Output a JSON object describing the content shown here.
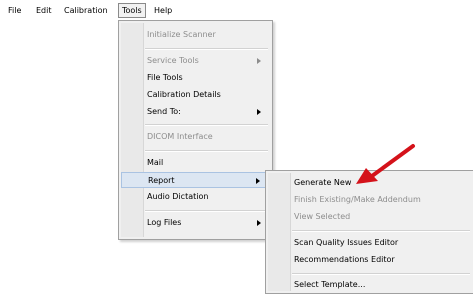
{
  "menubar": {
    "items": [
      {
        "label": "File"
      },
      {
        "label": "Edit"
      },
      {
        "label": "Calibration"
      },
      {
        "label": "Tools"
      },
      {
        "label": "Help"
      }
    ]
  },
  "tools_menu": {
    "items": [
      {
        "label": "Initialize Scanner",
        "enabled": false
      },
      {
        "label": "Service Tools",
        "enabled": false,
        "submenu": true
      },
      {
        "label": "File Tools",
        "enabled": true
      },
      {
        "label": "Calibration Details",
        "enabled": true
      },
      {
        "label": "Send To:",
        "enabled": true,
        "submenu": true
      },
      {
        "label": "DICOM Interface",
        "enabled": false
      },
      {
        "label": "Mail",
        "enabled": true
      },
      {
        "label": "Report",
        "enabled": true,
        "submenu": true,
        "highlighted": true
      },
      {
        "label": "Audio Dictation",
        "enabled": true
      },
      {
        "label": "Log Files",
        "enabled": true,
        "submenu": true
      }
    ]
  },
  "report_submenu": {
    "items": [
      {
        "label": "Generate New",
        "enabled": true
      },
      {
        "label": "Finish Existing/Make Addendum",
        "enabled": false
      },
      {
        "label": "View Selected",
        "enabled": false
      },
      {
        "label": "Scan Quality Issues Editor",
        "enabled": true
      },
      {
        "label": "Recommendations Editor",
        "enabled": true
      },
      {
        "label": "Select Template...",
        "enabled": true
      }
    ]
  },
  "annotation": {
    "arrow_color": "#d4121a",
    "points_to": "Generate New"
  }
}
